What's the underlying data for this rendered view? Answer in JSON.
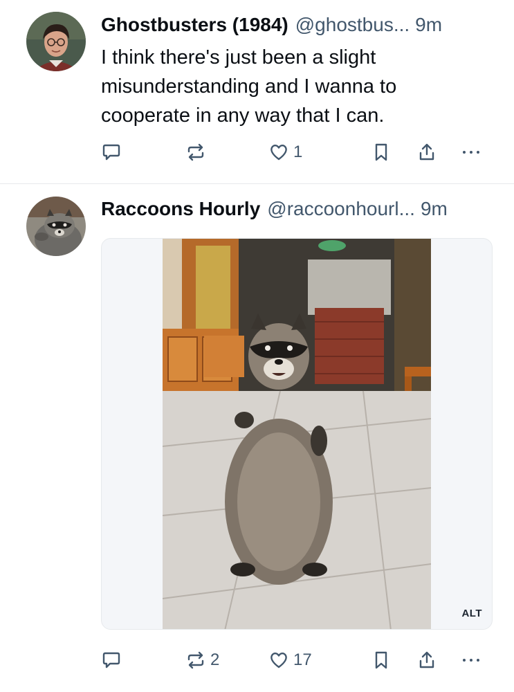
{
  "posts": [
    {
      "author": {
        "display_name": "Ghostbusters (1984)",
        "handle": "@ghostbus",
        "truncation": "...",
        "time": "9m",
        "avatar_icon": "person-with-glasses-avatar"
      },
      "text_lines": [
        "I think there's just been a slight",
        "misunderstanding and I wanna to",
        "cooperate in any way that I can."
      ],
      "actions": {
        "reply_count": "",
        "repost_count": "",
        "like_count": "1"
      }
    },
    {
      "author": {
        "display_name": "Raccoons Hourly",
        "handle": "@raccoonhourl",
        "truncation": "...",
        "time": "9m",
        "avatar_icon": "raccoon-avatar"
      },
      "media": {
        "alt_badge": "ALT",
        "image": "raccoon-standing-photo"
      },
      "actions": {
        "reply_count": "",
        "repost_count": "2",
        "like_count": "17"
      }
    }
  ],
  "colors": {
    "text": "#0b0f14",
    "muted": "#42576c",
    "divider": "#e6e9ec",
    "media_bg": "#f4f6f9"
  }
}
